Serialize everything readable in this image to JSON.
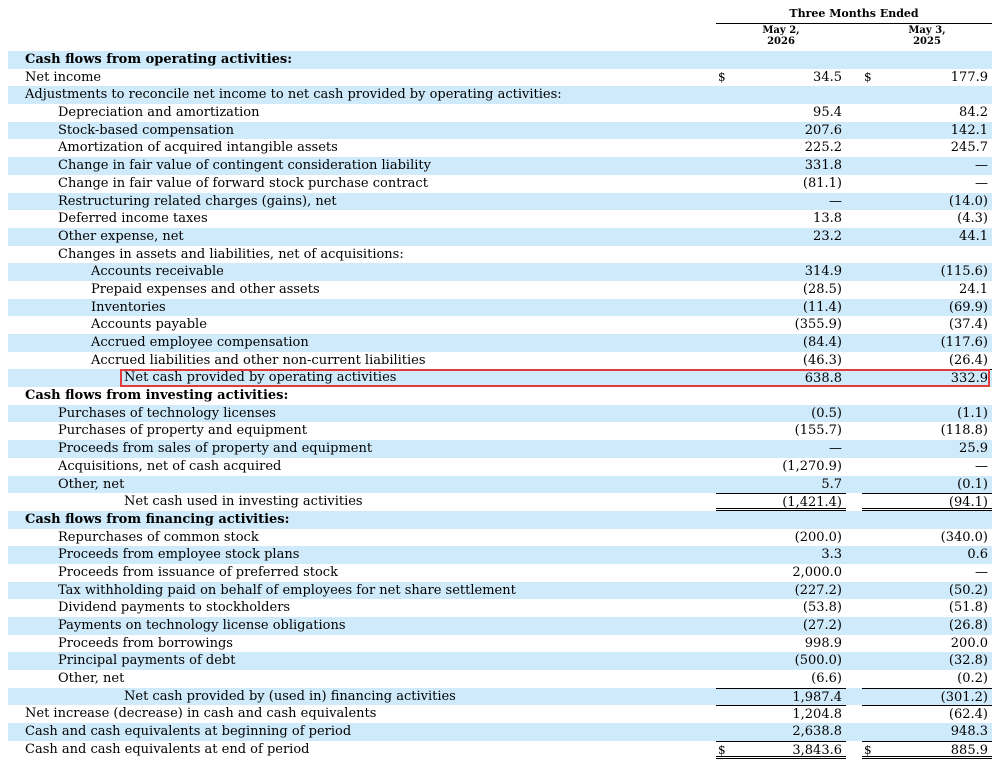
{
  "header": {
    "group_label": "Three Months Ended",
    "col1_line1": "May 2,",
    "col1_line2": "2026",
    "col2_line1": "May 3,",
    "col2_line2": "2025"
  },
  "rows": [
    {
      "label": "Cash flows from operating activities:",
      "level": 0,
      "hd": true,
      "a": "",
      "b": ""
    },
    {
      "label": "Net income",
      "level": 0,
      "a": "34.5",
      "b": "177.9",
      "cur": true
    },
    {
      "label": "Adjustments to reconcile net income to net cash provided by operating activities:",
      "level": 0,
      "a": "",
      "b": ""
    },
    {
      "label": "Depreciation and amortization",
      "level": 1,
      "a": "95.4",
      "b": "84.2"
    },
    {
      "label": "Stock-based compensation",
      "level": 1,
      "a": "207.6",
      "b": "142.1"
    },
    {
      "label": "Amortization of acquired intangible assets",
      "level": 1,
      "a": "225.2",
      "b": "245.7"
    },
    {
      "label": "Change in fair value of contingent consideration liability",
      "level": 1,
      "a": "331.8",
      "b": "—"
    },
    {
      "label": "Change in fair value of forward stock purchase contract",
      "level": 1,
      "a": "(81.1)",
      "b": "—"
    },
    {
      "label": "Restructuring related charges (gains), net",
      "level": 1,
      "a": "—",
      "b": "(14.0)"
    },
    {
      "label": "Deferred income taxes",
      "level": 1,
      "a": "13.8",
      "b": "(4.3)"
    },
    {
      "label": "Other expense, net",
      "level": 1,
      "a": "23.2",
      "b": "44.1"
    },
    {
      "label": "Changes in assets and liabilities, net of acquisitions:",
      "level": 1,
      "a": "",
      "b": ""
    },
    {
      "label": "Accounts receivable",
      "level": 2,
      "a": "314.9",
      "b": "(115.6)"
    },
    {
      "label": "Prepaid expenses and other assets",
      "level": 2,
      "a": "(28.5)",
      "b": "24.1"
    },
    {
      "label": "Inventories",
      "level": 2,
      "a": "(11.4)",
      "b": "(69.9)"
    },
    {
      "label": "Accounts payable",
      "level": 2,
      "a": "(355.9)",
      "b": "(37.4)"
    },
    {
      "label": "Accrued employee compensation",
      "level": 2,
      "a": "(84.4)",
      "b": "(117.6)"
    },
    {
      "label": "Accrued liabilities and other non-current liabilities",
      "level": 2,
      "a": "(46.3)",
      "b": "(26.4)"
    },
    {
      "label": "Net cash provided by operating activities",
      "level": 3,
      "a": "638.8",
      "b": "332.9",
      "bt": true
    },
    {
      "label": "Cash flows from investing activities:",
      "level": 0,
      "hd": true,
      "a": "",
      "b": ""
    },
    {
      "label": "Purchases of technology licenses",
      "level": 1,
      "a": "(0.5)",
      "b": "(1.1)"
    },
    {
      "label": "Purchases of property and equipment",
      "level": 1,
      "a": "(155.7)",
      "b": "(118.8)"
    },
    {
      "label": "Proceeds from sales of property and equipment",
      "level": 1,
      "a": "—",
      "b": "25.9"
    },
    {
      "label": "Acquisitions, net of cash acquired",
      "level": 1,
      "a": "(1,270.9)",
      "b": "—"
    },
    {
      "label": "Other, net",
      "level": 1,
      "a": "5.7",
      "b": "(0.1)"
    },
    {
      "label": "Net cash used in investing activities",
      "level": 3,
      "a": "(1,421.4)",
      "b": "(94.1)",
      "bt": true,
      "bdb": true
    },
    {
      "label": "Cash flows from financing activities:",
      "level": 0,
      "hd": true,
      "a": "",
      "b": ""
    },
    {
      "label": "Repurchases of common stock",
      "level": 1,
      "a": "(200.0)",
      "b": "(340.0)"
    },
    {
      "label": "Proceeds from employee stock plans",
      "level": 1,
      "a": "3.3",
      "b": "0.6"
    },
    {
      "label": "Proceeds from issuance of preferred stock",
      "level": 1,
      "a": "2,000.0",
      "b": "—"
    },
    {
      "label": "Tax withholding paid on behalf of employees for net share settlement",
      "level": 1,
      "a": "(227.2)",
      "b": "(50.2)"
    },
    {
      "label": "Dividend payments to stockholders",
      "level": 1,
      "a": "(53.8)",
      "b": "(51.8)"
    },
    {
      "label": "Payments on technology license obligations",
      "level": 1,
      "a": "(27.2)",
      "b": "(26.8)"
    },
    {
      "label": "Proceeds from borrowings",
      "level": 1,
      "a": "998.9",
      "b": "200.0"
    },
    {
      "label": "Principal payments of debt",
      "level": 1,
      "a": "(500.0)",
      "b": "(32.8)"
    },
    {
      "label": "Other, net",
      "level": 1,
      "a": "(6.6)",
      "b": "(0.2)"
    },
    {
      "label": "Net cash provided by (used in) financing activities",
      "level": 3,
      "a": "1,987.4",
      "b": "(301.2)",
      "bt": true
    },
    {
      "label": "Net increase (decrease) in cash and cash equivalents",
      "level": 0,
      "a": "1,204.8",
      "b": "(62.4)",
      "bt": true
    },
    {
      "label": "Cash and cash equivalents at beginning of period",
      "level": 0,
      "a": "2,638.8",
      "b": "948.3"
    },
    {
      "label": "Cash and cash equivalents at end of period",
      "level": 0,
      "a": "3,843.6",
      "b": "885.9",
      "cur": true,
      "bt": true,
      "bdb": true
    }
  ],
  "currency_symbol": "$",
  "highlight_row_label": "Net cash provided by operating activities"
}
